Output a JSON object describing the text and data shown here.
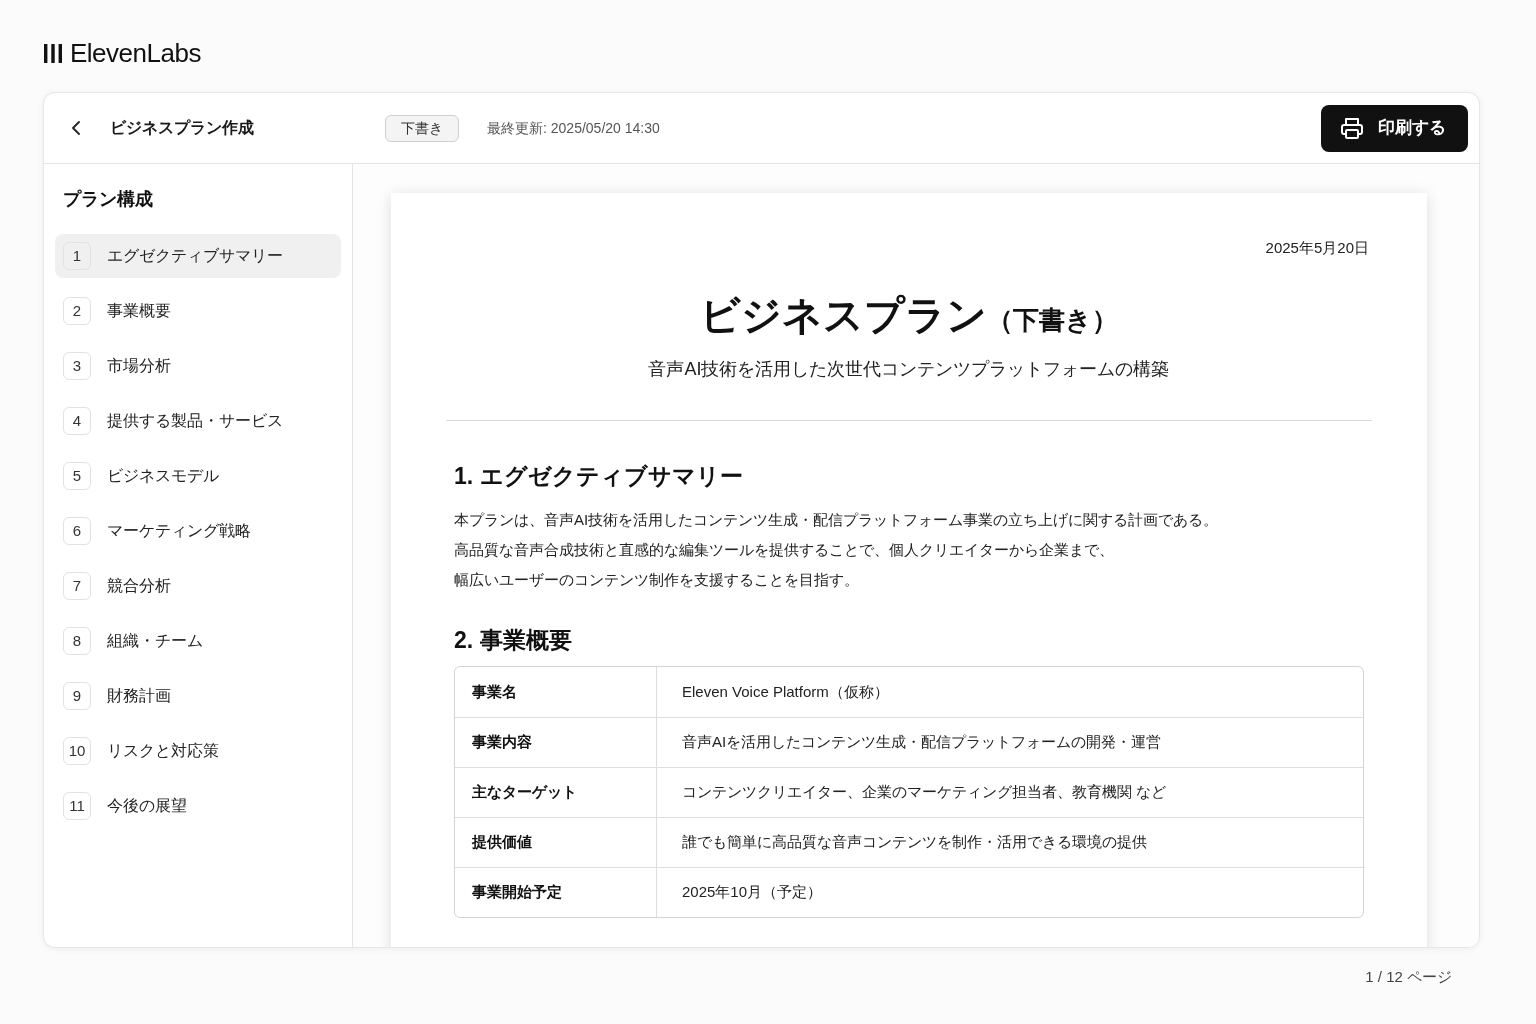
{
  "logo": {
    "text": "ElevenLabs"
  },
  "header": {
    "title": "ビジネスプラン作成",
    "status_badge": "下書き",
    "last_updated": "最終更新: 2025/05/20 14:30",
    "print_button": "印刷する"
  },
  "sidebar": {
    "heading": "プラン構成",
    "items": [
      {
        "number": "1",
        "label": "エグゼクティブサマリー",
        "selected": true
      },
      {
        "number": "2",
        "label": "事業概要",
        "selected": false
      },
      {
        "number": "3",
        "label": "市場分析",
        "selected": false
      },
      {
        "number": "4",
        "label": "提供する製品・サービス",
        "selected": false
      },
      {
        "number": "5",
        "label": "ビジネスモデル",
        "selected": false
      },
      {
        "number": "6",
        "label": "マーケティング戦略",
        "selected": false
      },
      {
        "number": "7",
        "label": "競合分析",
        "selected": false
      },
      {
        "number": "8",
        "label": "組織・チーム",
        "selected": false
      },
      {
        "number": "9",
        "label": "財務計画",
        "selected": false
      },
      {
        "number": "10",
        "label": "リスクと対応策",
        "selected": false
      },
      {
        "number": "11",
        "label": "今後の展望",
        "selected": false
      }
    ]
  },
  "document": {
    "date": "2025年5月20日",
    "title": "ビジネスプラン",
    "title_suffix": "（下書き）",
    "subtitle": "音声AI技術を活用した次世代コンテンツプラットフォームの構築",
    "sections": [
      {
        "kind": "paragraph",
        "heading": "1. エグゼクティブサマリー",
        "lines": [
          "本プランは、音声AI技術を活用したコンテンツ生成・配信プラットフォーム事業の立ち上げに関する計画である。",
          "高品質な音声合成技術と直感的な編集ツールを提供することで、個人クリエイターから企業まで、",
          "幅広いユーザーのコンテンツ制作を支援することを目指す。"
        ]
      },
      {
        "kind": "table",
        "heading": "2. 事業概要",
        "rows": [
          {
            "label": "事業名",
            "value": "Eleven Voice Platform（仮称）"
          },
          {
            "label": "事業内容",
            "value": "音声AIを活用したコンテンツ生成・配信プラットフォームの開発・運営"
          },
          {
            "label": "主なターゲット",
            "value": "コンテンツクリエイター、企業のマーケティング担当者、教育機関 など"
          },
          {
            "label": "提供価値",
            "value": "誰でも簡単に高品質な音声コンテンツを制作・活用できる環境の提供"
          },
          {
            "label": "事業開始予定",
            "value": "2025年10月（予定）"
          }
        ]
      }
    ]
  },
  "pagination": "1 / 12 ページ"
}
